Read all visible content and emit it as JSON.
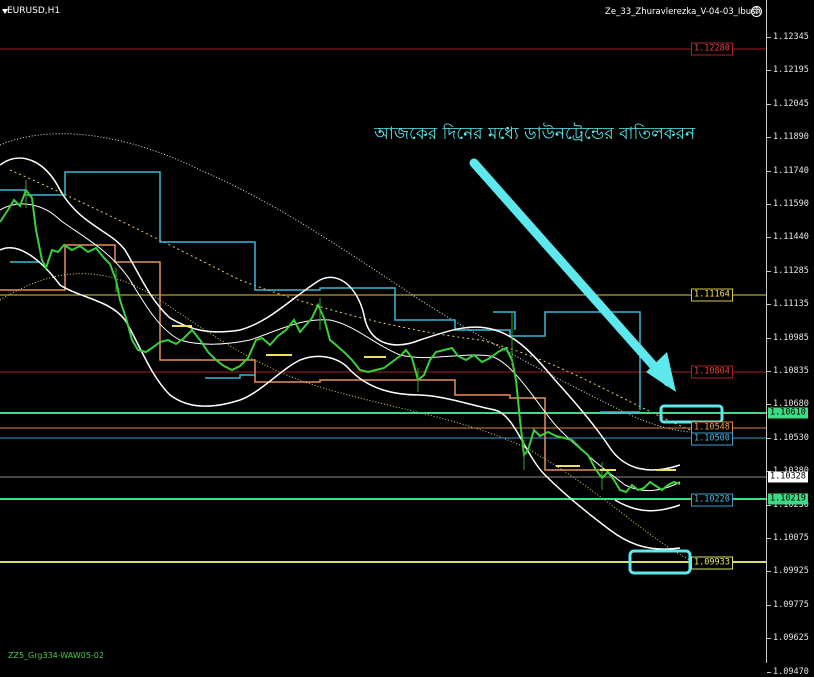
{
  "chart": {
    "symbol": "EURUSD,H1",
    "indicator": "Ze_33_Zhuravlerezka_V-04-03_Ibush",
    "annotation": "আজকের দিনের মধ্যে ডাউনট্রেন্ডের বাতিলকরন",
    "bottom_label": "ZZ5_Grg334-WAW05-02",
    "current_price": "1.10328"
  },
  "price_axis": {
    "ticks": [
      "1.12345",
      "1.12195",
      "1.12045",
      "1.11890",
      "1.11740",
      "1.11590",
      "1.11440",
      "1.11285",
      "1.11135",
      "1.10985",
      "1.10835",
      "1.10680",
      "1.10530",
      "1.10380",
      "1.10230",
      "1.10075",
      "1.09925",
      "1.09775",
      "1.09625",
      "1.09470"
    ],
    "flags": [
      {
        "text": "1.10610",
        "bg": "#3ddc84",
        "fg": "#000000"
      },
      {
        "text": "1.10328",
        "bg": "#ffffff",
        "fg": "#000000"
      },
      {
        "text": "1.10219",
        "bg": "#3ddc84",
        "fg": "#000000"
      }
    ]
  },
  "levels": [
    {
      "label": "1.12280",
      "color": "#e0443a",
      "line": "#a82020"
    },
    {
      "label": "1.11164",
      "color": "#f0e060",
      "line": "#d8c84a"
    },
    {
      "label": "1.10804",
      "color": "#e0443a",
      "line": "#a82020"
    },
    {
      "label": "1.10548",
      "color": "#f0a04a",
      "line": "#d88a38"
    },
    {
      "label": "1.10500",
      "color": "#4ab8e8",
      "line": "#3aa0d0"
    },
    {
      "label": "1.10220",
      "color": "#4ab8e8",
      "line": "#3aa0d0"
    },
    {
      "label": "1.09933",
      "color": "#e8e860",
      "line": "#d8e060"
    }
  ],
  "colors": {
    "candles": "#3ccf3c",
    "bands": "#ffffff",
    "step_upper": "#3ab8d8",
    "step_lower": "#e8905a",
    "highlight": "#5ce8ec",
    "arrow": "#5ce8ec",
    "green_level": "#3ddc84"
  }
}
